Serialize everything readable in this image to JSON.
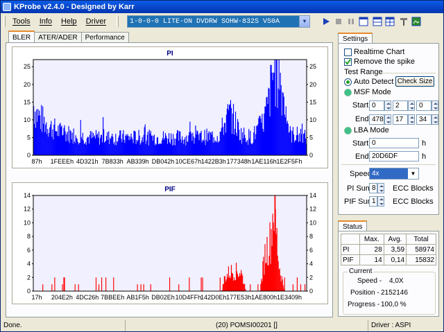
{
  "title": "KProbe v2.4.0 - Designed by Karr",
  "menu": [
    "Tools",
    "Info",
    "Help",
    "Driver"
  ],
  "drive": "1-0-0-0 LITE-ON DVDRW SOHW-832S  VS0A",
  "tabs": [
    "BLER",
    "ATER/ADER",
    "Performance"
  ],
  "pi_chart": {
    "title": "PI",
    "yticks": [
      "25",
      "20",
      "15",
      "10",
      "5",
      "0"
    ],
    "xticks": [
      "87h",
      "1FEEEh",
      "4D321h",
      "7B833h",
      "AB339h",
      "DB042h",
      "10CE67h",
      "1422B3h",
      "177348h",
      "1AE116h",
      "1E2F5Fh"
    ]
  },
  "pif_chart": {
    "title": "PIF",
    "yticks": [
      "14",
      "12",
      "10",
      "8",
      "6",
      "4",
      "2",
      "0"
    ],
    "xticks": [
      "17h",
      "204E2h",
      "4DC26h",
      "7BBEEh",
      "AB1F5h",
      "DB02Eh",
      "10D4FFh",
      "142D0Eh",
      "177E53h",
      "1AE800h",
      "1E3409h"
    ]
  },
  "chart_data": [
    {
      "type": "bar",
      "title": "PI",
      "ylim": [
        0,
        27
      ],
      "max": 28,
      "avg": 3.59,
      "total": 58974,
      "color": "#0000ff",
      "x_ticks": [
        "87h",
        "1FEEEh",
        "4D321h",
        "7B833h",
        "AB339h",
        "DB042h",
        "10CE67h",
        "1422B3h",
        "177348h",
        "1AE116h",
        "1E2F5Fh"
      ],
      "profile": [
        [
          0,
          14
        ],
        [
          0.01,
          12
        ],
        [
          0.03,
          10
        ],
        [
          0.06,
          8
        ],
        [
          0.1,
          6.5
        ],
        [
          0.2,
          5
        ],
        [
          0.3,
          5
        ],
        [
          0.4,
          5
        ],
        [
          0.5,
          5
        ],
        [
          0.6,
          5
        ],
        [
          0.68,
          5.5
        ],
        [
          0.7,
          9
        ],
        [
          0.72,
          12
        ],
        [
          0.74,
          9
        ],
        [
          0.76,
          6
        ],
        [
          0.8,
          5
        ],
        [
          0.84,
          9
        ],
        [
          0.86,
          14
        ],
        [
          0.88,
          24
        ],
        [
          0.9,
          23
        ],
        [
          0.92,
          15
        ],
        [
          0.94,
          6
        ],
        [
          1,
          5
        ]
      ]
    },
    {
      "type": "bar",
      "title": "PIF",
      "ylim": [
        0,
        14
      ],
      "max": 14,
      "avg": 0.14,
      "total": 15832,
      "color": "#ff0000",
      "x_ticks": [
        "17h",
        "204E2h",
        "4DC26h",
        "7BBEEh",
        "AB1F5h",
        "DB02Eh",
        "10D4FFh",
        "142D0Eh",
        "177E53h",
        "1AE800h",
        "1E3409h"
      ],
      "profile": [
        [
          0,
          0
        ],
        [
          0.69,
          0
        ],
        [
          0.7,
          2
        ],
        [
          0.72,
          3
        ],
        [
          0.76,
          3
        ],
        [
          0.78,
          0
        ],
        [
          0.83,
          0
        ],
        [
          0.85,
          6
        ],
        [
          0.87,
          8
        ],
        [
          0.88,
          14
        ],
        [
          0.89,
          9
        ],
        [
          0.9,
          4
        ],
        [
          0.92,
          0
        ],
        [
          1,
          0
        ]
      ]
    }
  ],
  "settings": {
    "tab": "Settings",
    "realtime_chart": "Realtime Chart",
    "remove_spike": "Remove the spike",
    "test_range": "Test Range",
    "auto_detect": "Auto Detect",
    "check_size": "Check Size",
    "msf_mode": "MSF Mode",
    "start_label": "Start",
    "start_msf": [
      "0",
      "2",
      "0"
    ],
    "end_label": "End",
    "end_msf": [
      "478",
      "17",
      "34"
    ],
    "lba_mode": "LBA Mode",
    "lba_start": "0",
    "lba_end": "20D6DF",
    "h_unit": "h",
    "speed_label": "Speed",
    "speed_value": "4x",
    "pi_sum_label": "PI Sum",
    "pi_sum_value": "8",
    "pif_sum_label": "PIF Sum",
    "pif_sum_value": "1",
    "ecc_blocks": "ECC Blocks"
  },
  "status": {
    "tab": "Status",
    "headers": [
      "",
      "Max.",
      "Avg.",
      "Total"
    ],
    "rows": [
      [
        "PI",
        "28",
        "3,59",
        "58974"
      ],
      [
        "PIF",
        "14",
        "0,14",
        "15832"
      ]
    ],
    "current_label": "Current",
    "speed_label": "Speed -",
    "speed_value": "4,0X",
    "position_label": "Position -",
    "position_value": "2152146",
    "progress_label": "Progress -",
    "progress_value": "100,0 %"
  },
  "statusbar": {
    "left": "Done.",
    "middle": "(20) POMSI00201 []",
    "right": "Driver : ASPI"
  }
}
